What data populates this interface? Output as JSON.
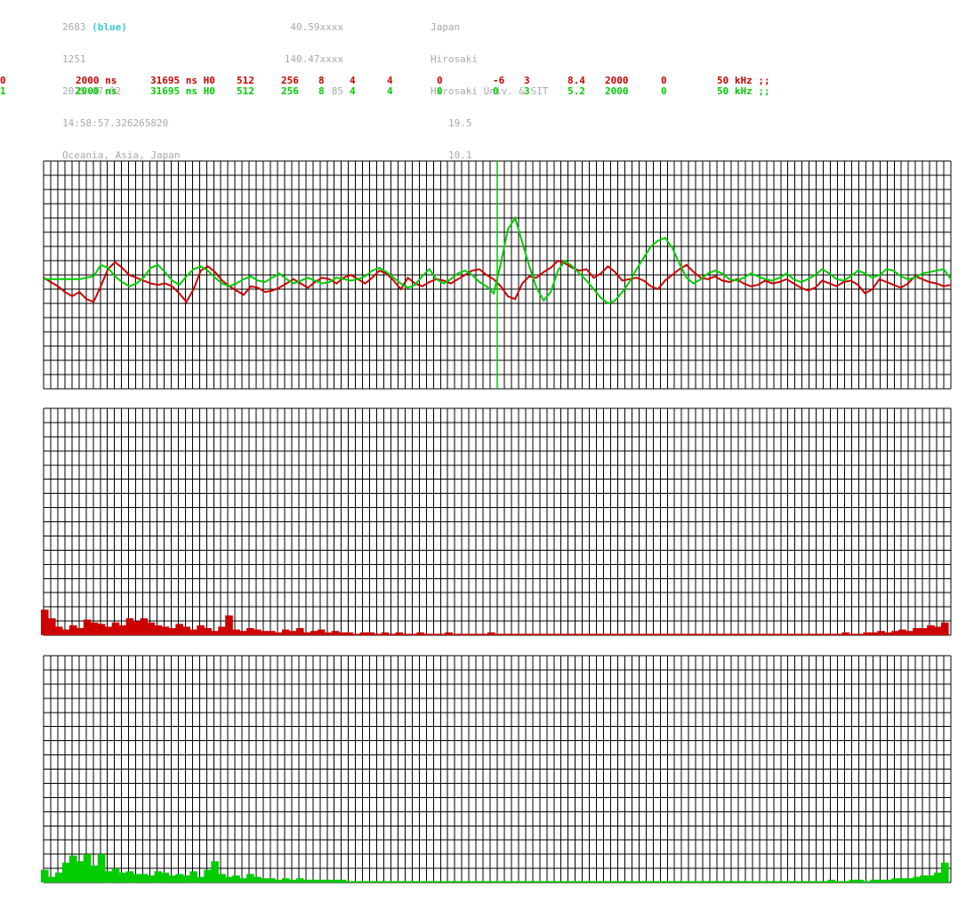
{
  "station": {
    "id": "2683",
    "id_color_label": "(blue)",
    "number": "1251",
    "date": "2025-07-02",
    "time": "14:58:57.326265820",
    "region": "Oceania, Asia, Japan",
    "lat": "40.59xxxx",
    "lon": "140.47xxxx",
    "alt": "85",
    "country": "Japan",
    "city": "Hirosaki",
    "org": "Hirosaki Univ. & SIT",
    "val1": "19.5",
    "val2": "10.1"
  },
  "channels": [
    {
      "ch": "0",
      "f1": "2000 ns",
      "f2": "31695 ns H0",
      "f3": "512",
      "f4": "256",
      "f5": "8",
      "f6": "4",
      "f7": "4",
      "f8": "0",
      "f9": "-6",
      "f10": "3",
      "f11": "8.4",
      "f12": "2000",
      "f13": "0",
      "f14": "50 kHz ;;",
      "color": "#cc0000"
    },
    {
      "ch": "1",
      "f1": "2000 ns",
      "f2": "31695 ns H0",
      "f3": "512",
      "f4": "256",
      "f5": "8",
      "f6": "4",
      "f7": "4",
      "f8": "0",
      "f9": "0",
      "f10": "3",
      "f11": "5.2",
      "f12": "2000",
      "f13": "0",
      "f14": "50 kHz ;;",
      "color": "#00cc00"
    }
  ],
  "chart_data": [
    {
      "type": "line",
      "panel": "waveform",
      "title": "",
      "xlabel": "",
      "ylabel": "",
      "grid": true,
      "x_range": [
        0,
        128
      ],
      "ylim": [
        -8,
        8
      ],
      "marker_x": 64,
      "series": [
        {
          "color": "#cc0000",
          "values": [
            -0.2,
            -0.5,
            -0.8,
            -1.2,
            -1.5,
            -1.2,
            -1.7,
            -1.9,
            -0.8,
            0.4,
            0.9,
            0.5,
            0.0,
            -0.2,
            -0.4,
            -0.6,
            -0.7,
            -0.6,
            -0.8,
            -1.3,
            -1.9,
            -1.0,
            0.3,
            0.6,
            0.2,
            -0.4,
            -0.8,
            -1.1,
            -1.4,
            -0.8,
            -0.9,
            -1.2,
            -1.1,
            -0.9,
            -0.6,
            -0.3,
            -0.6,
            -0.9,
            -0.5,
            -0.2,
            -0.3,
            -0.6,
            -0.2,
            0.0,
            -0.3,
            -0.6,
            -0.2,
            0.3,
            0.1,
            -0.4,
            -1.0,
            -0.2,
            -0.6,
            -0.8,
            -0.5,
            -0.3,
            -0.4,
            -0.6,
            -0.3,
            0.0,
            0.3,
            0.4,
            0.0,
            -0.3,
            -0.8,
            -1.5,
            -1.7,
            -0.6,
            -0.1,
            -0.2,
            0.2,
            0.5,
            1.0,
            0.8,
            0.5,
            0.3,
            0.4,
            -0.2,
            0.1,
            0.6,
            0.2,
            -0.4,
            -0.3,
            -0.2,
            -0.4,
            -0.8,
            -1.0,
            -0.4,
            0.0,
            0.4,
            0.7,
            0.2,
            -0.2,
            -0.3,
            -0.1,
            -0.4,
            -0.5,
            -0.3,
            -0.6,
            -0.8,
            -0.7,
            -0.4,
            -0.6,
            -0.5,
            -0.3,
            -0.6,
            -0.9,
            -1.1,
            -0.9,
            -0.4,
            -0.6,
            -0.8,
            -0.5,
            -0.4,
            -0.7,
            -1.3,
            -1.0,
            -0.3,
            -0.5,
            -0.7,
            -0.9,
            -0.6,
            -0.1,
            -0.3,
            -0.5,
            -0.6,
            -0.8,
            -0.7
          ]
        },
        {
          "color": "#00cc00",
          "values": [
            -0.3,
            -0.3,
            -0.3,
            -0.3,
            -0.3,
            -0.3,
            -0.2,
            -0.1,
            0.7,
            0.5,
            -0.1,
            -0.5,
            -0.8,
            -0.6,
            -0.2,
            0.5,
            0.7,
            0.2,
            -0.4,
            -0.7,
            -0.1,
            0.4,
            0.6,
            0.3,
            -0.2,
            -0.6,
            -0.8,
            -0.6,
            -0.3,
            -0.1,
            -0.4,
            -0.5,
            -0.2,
            0.1,
            -0.3,
            -0.6,
            -0.4,
            -0.2,
            -0.4,
            -0.6,
            -0.5,
            -0.2,
            -0.3,
            -0.4,
            -0.3,
            -0.1,
            0.3,
            0.5,
            0.2,
            -0.2,
            -0.6,
            -0.9,
            -0.7,
            -0.1,
            0.4,
            -0.3,
            -0.6,
            -0.3,
            0.1,
            0.3,
            0.0,
            -0.5,
            -0.8,
            -1.3,
            0.8,
            3.2,
            4.0,
            2.3,
            0.6,
            -0.9,
            -1.8,
            -1.2,
            0.3,
            1.0,
            0.6,
            0.1,
            -0.4,
            -1.0,
            -1.6,
            -2.0,
            -1.8,
            -1.2,
            -0.5,
            0.4,
            1.2,
            2.0,
            2.4,
            2.6,
            1.9,
            0.8,
            -0.2,
            -0.6,
            -0.3,
            0.1,
            0.3,
            0.1,
            -0.3,
            -0.4,
            -0.2,
            0.1,
            -0.1,
            -0.3,
            -0.4,
            -0.2,
            0.1,
            -0.3,
            -0.5,
            -0.3,
            0.0,
            0.4,
            0.1,
            -0.3,
            -0.4,
            -0.1,
            0.3,
            0.1,
            -0.2,
            0.0,
            0.4,
            0.3,
            -0.1,
            -0.3,
            -0.2,
            0.1,
            0.2,
            0.3,
            0.4,
            -0.3
          ]
        }
      ]
    },
    {
      "type": "bar",
      "panel": "spectrum-red",
      "title": "",
      "xlabel": "",
      "ylabel": "",
      "grid": true,
      "color": "#cc0000",
      "ylim": [
        0,
        16
      ],
      "values": [
        1.8,
        1.2,
        0.6,
        0.4,
        0.7,
        0.5,
        1.1,
        0.9,
        0.8,
        0.6,
        0.9,
        0.7,
        1.2,
        1.0,
        1.2,
        0.9,
        0.7,
        0.6,
        0.5,
        0.8,
        0.6,
        0.4,
        0.7,
        0.5,
        0.3,
        0.6,
        1.4,
        0.4,
        0.3,
        0.5,
        0.4,
        0.3,
        0.3,
        0.2,
        0.4,
        0.3,
        0.5,
        0.2,
        0.3,
        0.4,
        0.2,
        0.3,
        0.2,
        0.2,
        0.1,
        0.2,
        0.2,
        0.1,
        0.2,
        0.1,
        0.2,
        0.1,
        0.1,
        0.2,
        0.1,
        0.1,
        0.1,
        0.2,
        0.1,
        0.1,
        0.1,
        0.1,
        0.1,
        0.2,
        0.1,
        0.1,
        0.1,
        0.1,
        0.1,
        0.1,
        0.1,
        0.1,
        0.1,
        0.1,
        0.1,
        0.1,
        0.1,
        0.1,
        0.1,
        0.1,
        0.1,
        0.1,
        0.1,
        0.1,
        0.1,
        0.1,
        0.1,
        0.1,
        0.1,
        0.1,
        0.1,
        0.1,
        0.1,
        0.1,
        0.1,
        0.1,
        0.1,
        0.1,
        0.1,
        0.1,
        0.1,
        0.1,
        0.1,
        0.1,
        0.1,
        0.1,
        0.1,
        0.1,
        0.1,
        0.1,
        0.1,
        0.1,
        0.1,
        0.2,
        0.1,
        0.1,
        0.2,
        0.2,
        0.3,
        0.2,
        0.3,
        0.4,
        0.3,
        0.5,
        0.5,
        0.7,
        0.6,
        0.9
      ]
    },
    {
      "type": "bar",
      "panel": "spectrum-green",
      "title": "",
      "xlabel": "",
      "ylabel": "",
      "grid": true,
      "color": "#00cc00",
      "ylim": [
        0,
        16
      ],
      "values": [
        0.9,
        0.4,
        0.7,
        1.4,
        1.9,
        1.5,
        2.0,
        1.2,
        2.0,
        0.8,
        1.0,
        0.7,
        0.8,
        0.6,
        0.6,
        0.5,
        0.8,
        0.7,
        0.5,
        0.6,
        0.5,
        0.8,
        0.4,
        0.9,
        1.5,
        0.6,
        0.4,
        0.5,
        0.3,
        0.6,
        0.4,
        0.3,
        0.3,
        0.2,
        0.3,
        0.2,
        0.3,
        0.2,
        0.2,
        0.2,
        0.2,
        0.2,
        0.2,
        0.1,
        0.1,
        0.1,
        0.1,
        0.1,
        0.1,
        0.1,
        0.1,
        0.1,
        0.1,
        0.1,
        0.1,
        0.1,
        0.1,
        0.1,
        0.1,
        0.1,
        0.1,
        0.1,
        0.1,
        0.1,
        0.1,
        0.1,
        0.1,
        0.1,
        0.1,
        0.1,
        0.1,
        0.1,
        0.1,
        0.1,
        0.1,
        0.1,
        0.1,
        0.1,
        0.1,
        0.1,
        0.1,
        0.1,
        0.1,
        0.1,
        0.1,
        0.1,
        0.1,
        0.1,
        0.1,
        0.1,
        0.1,
        0.1,
        0.1,
        0.1,
        0.1,
        0.1,
        0.1,
        0.1,
        0.1,
        0.1,
        0.1,
        0.1,
        0.1,
        0.1,
        0.1,
        0.1,
        0.1,
        0.1,
        0.1,
        0.1,
        0.1,
        0.2,
        0.1,
        0.1,
        0.2,
        0.2,
        0.1,
        0.2,
        0.2,
        0.2,
        0.3,
        0.3,
        0.3,
        0.4,
        0.5,
        0.5,
        0.7,
        1.4
      ]
    }
  ]
}
